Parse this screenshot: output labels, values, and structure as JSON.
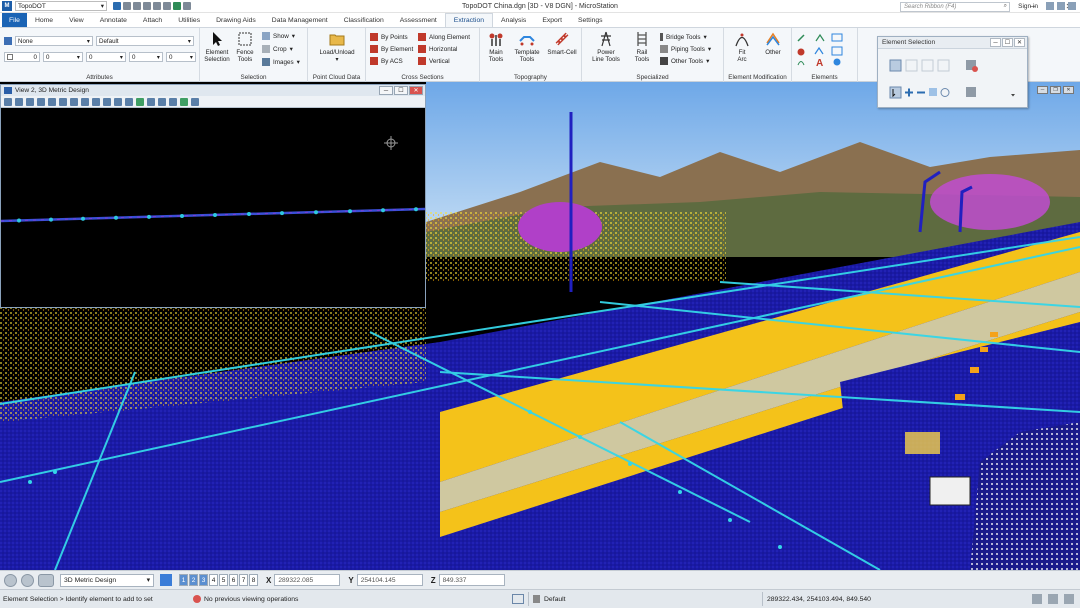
{
  "window": {
    "title": "TopoDOT China.dgn [3D - V8 DGN] - MicroStation",
    "workspace": "TopoDOT"
  },
  "ribbon_tabs": [
    "File",
    "Home",
    "View",
    "Annotate",
    "Attach",
    "Utilities",
    "Drawing Aids",
    "Data Management",
    "Classification",
    "Assessment",
    "Extraction",
    "Analysis",
    "Export",
    "Settings"
  ],
  "search": {
    "placeholder": "Search Ribbon (F4)"
  },
  "signin": "Sign in",
  "groups": {
    "attributes": {
      "label": "Attributes",
      "level": "None",
      "style": "Default",
      "color_value": "0",
      "weight_value": "0",
      "line_value": "0",
      "trans_value": "0",
      "prio_value": "0"
    },
    "selection": {
      "label": "Selection",
      "element_selection": "Element\nSelection",
      "fence_tools": "Fence\nTools",
      "show": "Show",
      "crop": "Crop",
      "images": "Images"
    },
    "pointcloud": {
      "label": "Point Cloud Data",
      "load_unload": "Load/Unload"
    },
    "cross_sections": {
      "label": "Cross Sections",
      "by_points": "By Points",
      "by_element": "By Element",
      "by_acs": "By ACS",
      "along_element": "Along Element",
      "horizontal": "Horizontal",
      "vertical": "Vertical"
    },
    "topography": {
      "label": "Topography",
      "main_tools": "Main\nTools",
      "template_tools": "Template\nTools",
      "smart_cell": "Smart-Cell"
    },
    "specialized": {
      "label": "Specialized",
      "power_line": "Power\nLine Tools",
      "rail_tools": "Rail\nTools",
      "bridge_tools": "Bridge Tools",
      "piping_tools": "Piping Tools",
      "other_tools": "Other Tools"
    },
    "element_mod": {
      "label": "Element Modification",
      "fit_arc": "Fit\nArc",
      "other": "Other"
    },
    "elements": {
      "label": "Elements"
    }
  },
  "element_selection_dialog": {
    "title": "Element Selection"
  },
  "view2": {
    "title": "View 2, 3D Metric Design"
  },
  "viewbar": {
    "view_combo": "3D Metric Design",
    "view_numbers": [
      "1",
      "2",
      "3",
      "4",
      "5",
      "6",
      "7",
      "8"
    ],
    "x_label": "X",
    "y_label": "Y",
    "z_label": "Z",
    "x_value": "289322.085",
    "y_value": "254104.145",
    "z_value": "849.337"
  },
  "statusbar": {
    "prompt": "Element Selection > Identify element to add to set",
    "message": "No previous viewing operations",
    "level": "Default",
    "coords": "289322.434, 254103.494, 849.540"
  }
}
